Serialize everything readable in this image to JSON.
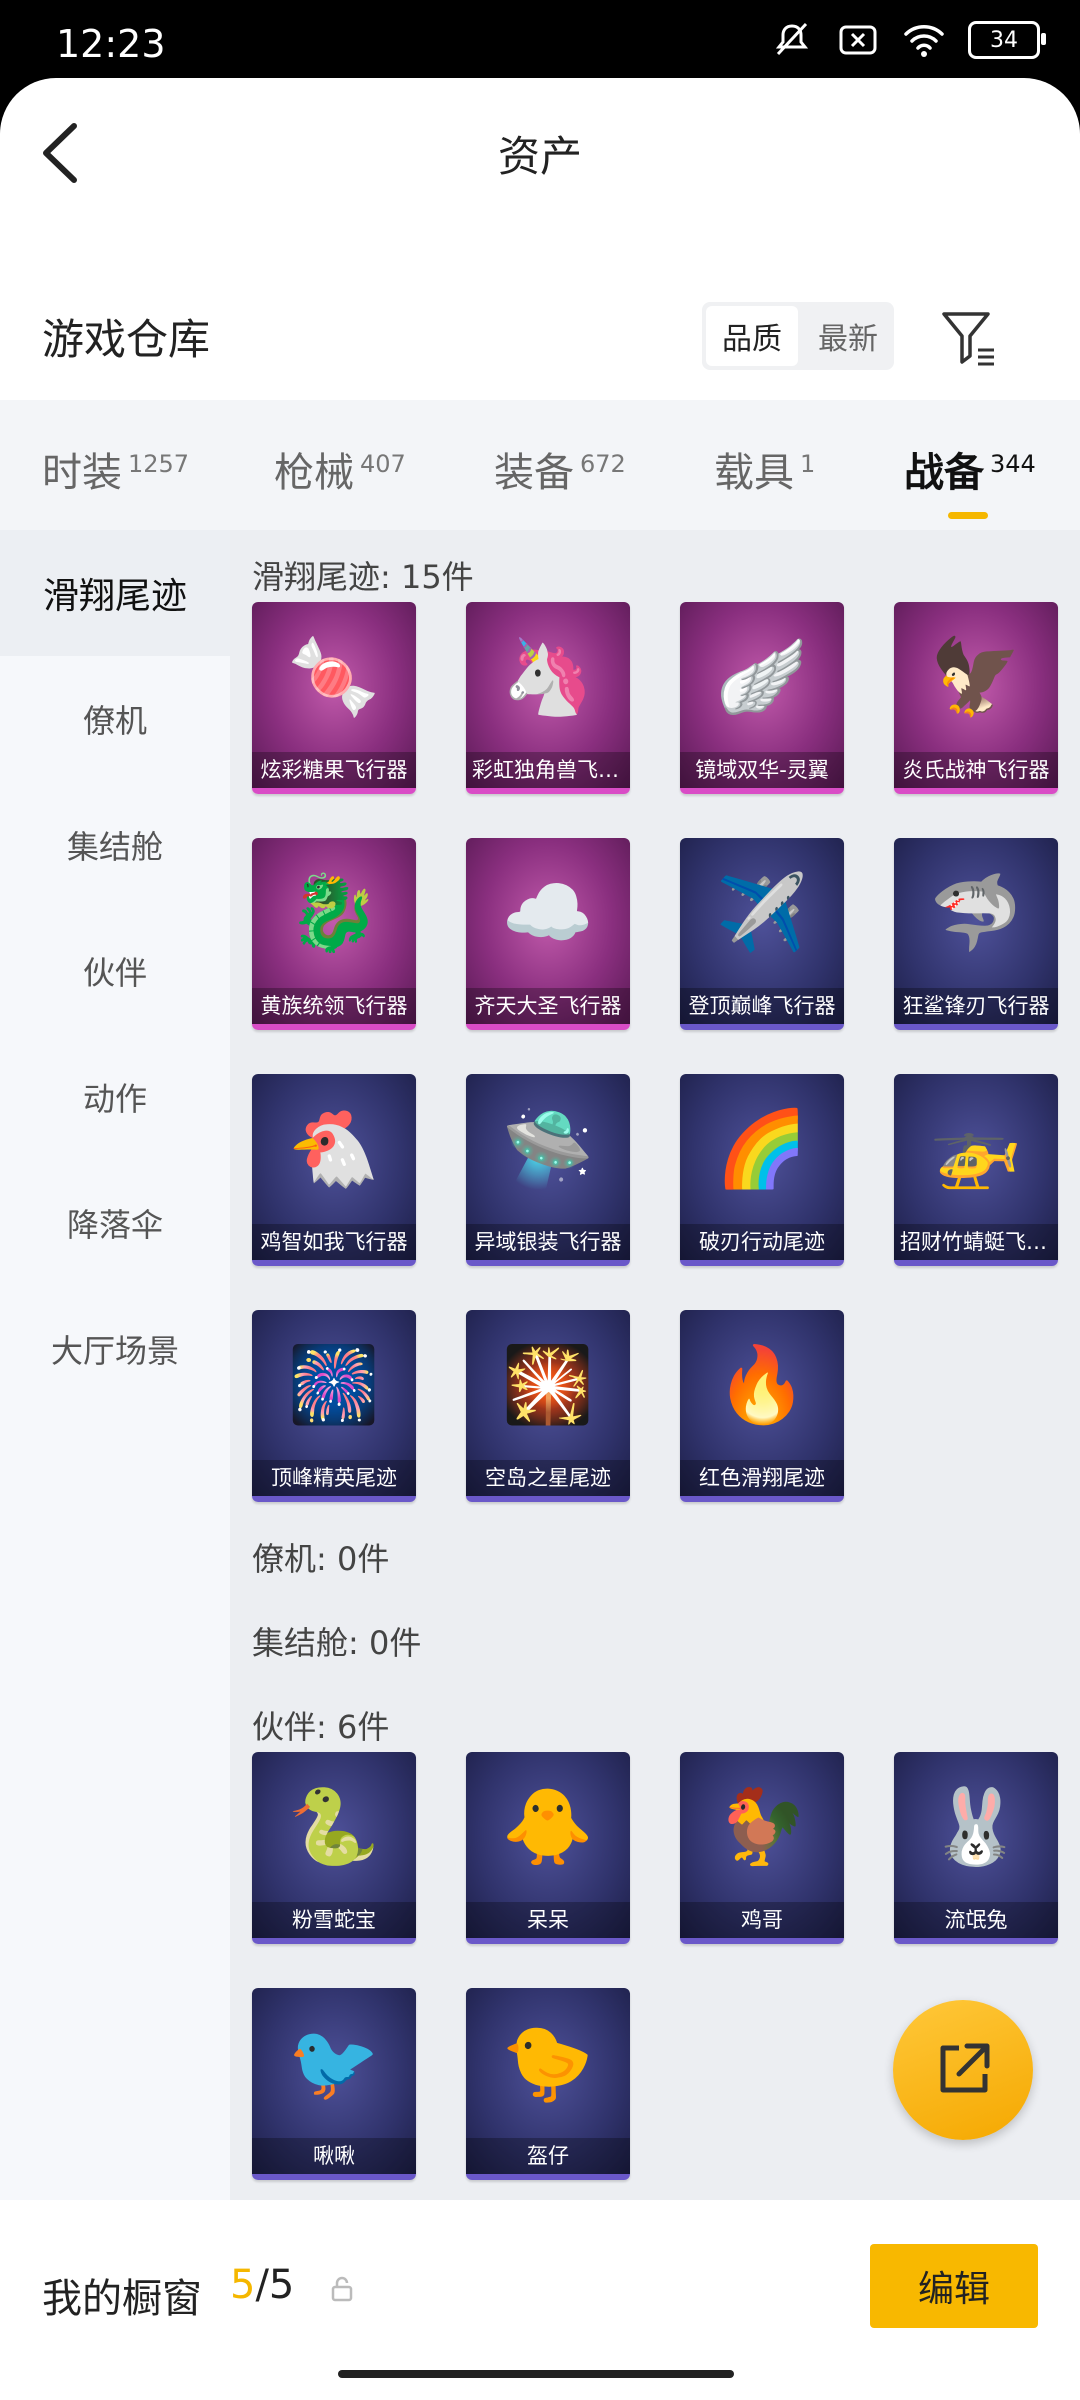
{
  "status": {
    "time": "12:23",
    "battery": "34"
  },
  "header": {
    "title": "资产"
  },
  "warehouse": {
    "title": "游戏仓库",
    "sort_options": [
      "品质",
      "最新"
    ],
    "active_sort": "品质"
  },
  "tabs": [
    {
      "label": "时装",
      "count": "1257"
    },
    {
      "label": "枪械",
      "count": "407"
    },
    {
      "label": "装备",
      "count": "672"
    },
    {
      "label": "载具",
      "count": "1"
    },
    {
      "label": "战备",
      "count": "344",
      "active": true
    }
  ],
  "sidebar": [
    "滑翔尾迹",
    "僚机",
    "集结舱",
    "伙伴",
    "动作",
    "降落伞",
    "大厅场景"
  ],
  "sections": {
    "glide": {
      "title": "滑翔尾迹: 15件",
      "items": [
        {
          "name": "炫彩糖果飞行器",
          "art": "🍬",
          "rarity": "pink"
        },
        {
          "name": "彩虹独角兽飞行器",
          "art": "🦄",
          "rarity": "pink"
        },
        {
          "name": "镜域双华-灵翼",
          "art": "🪽",
          "rarity": "pink"
        },
        {
          "name": "炎氏战神飞行器",
          "art": "🦅",
          "rarity": "pink"
        },
        {
          "name": "黄族统领飞行器",
          "art": "🐉",
          "rarity": "pink"
        },
        {
          "name": "齐天大圣飞行器",
          "art": "☁️",
          "rarity": "pink"
        },
        {
          "name": "登顶巅峰飞行器",
          "art": "✈️",
          "rarity": "blue"
        },
        {
          "name": "狂鲨锋刃飞行器",
          "art": "🦈",
          "rarity": "blue"
        },
        {
          "name": "鸡智如我飞行器",
          "art": "🐔",
          "rarity": "blue"
        },
        {
          "name": "异域银装飞行器",
          "art": "🛸",
          "rarity": "blue"
        },
        {
          "name": "破刃行动尾迹",
          "art": "🌈",
          "rarity": "blue"
        },
        {
          "name": "招财竹蜻蜓飞行器",
          "art": "🚁",
          "rarity": "blue"
        },
        {
          "name": "顶峰精英尾迹",
          "art": "🎆",
          "rarity": "blue"
        },
        {
          "name": "空岛之星尾迹",
          "art": "🎇",
          "rarity": "blue"
        },
        {
          "name": "红色滑翔尾迹",
          "art": "🔥",
          "rarity": "blue"
        }
      ]
    },
    "wingman": {
      "title": "僚机: 0件"
    },
    "capsule": {
      "title": "集结舱: 0件"
    },
    "partner": {
      "title": "伙伴: 6件",
      "items": [
        {
          "name": "粉雪蛇宝",
          "art": "🐍",
          "rarity": "blue"
        },
        {
          "name": "呆呆",
          "art": "🐥",
          "rarity": "blue"
        },
        {
          "name": "鸡哥",
          "art": "🐓",
          "rarity": "blue"
        },
        {
          "name": "流氓兔",
          "art": "🐰",
          "rarity": "blue"
        },
        {
          "name": "啾啾",
          "art": "🐦",
          "rarity": "blue"
        },
        {
          "name": "盔仔",
          "art": "🐤",
          "rarity": "blue"
        }
      ]
    }
  },
  "bottom": {
    "label": "我的橱窗",
    "count_current": "5",
    "count_total": "/5",
    "edit": "编辑"
  },
  "icons": {
    "back": "chevron-left-icon",
    "filter": "filter-icon",
    "share": "external-link-icon",
    "lock": "lock-icon"
  },
  "colors": {
    "accent": "#f5b700",
    "pink_rarity": "#d94cc6",
    "blue_rarity": "#6a58c9"
  }
}
